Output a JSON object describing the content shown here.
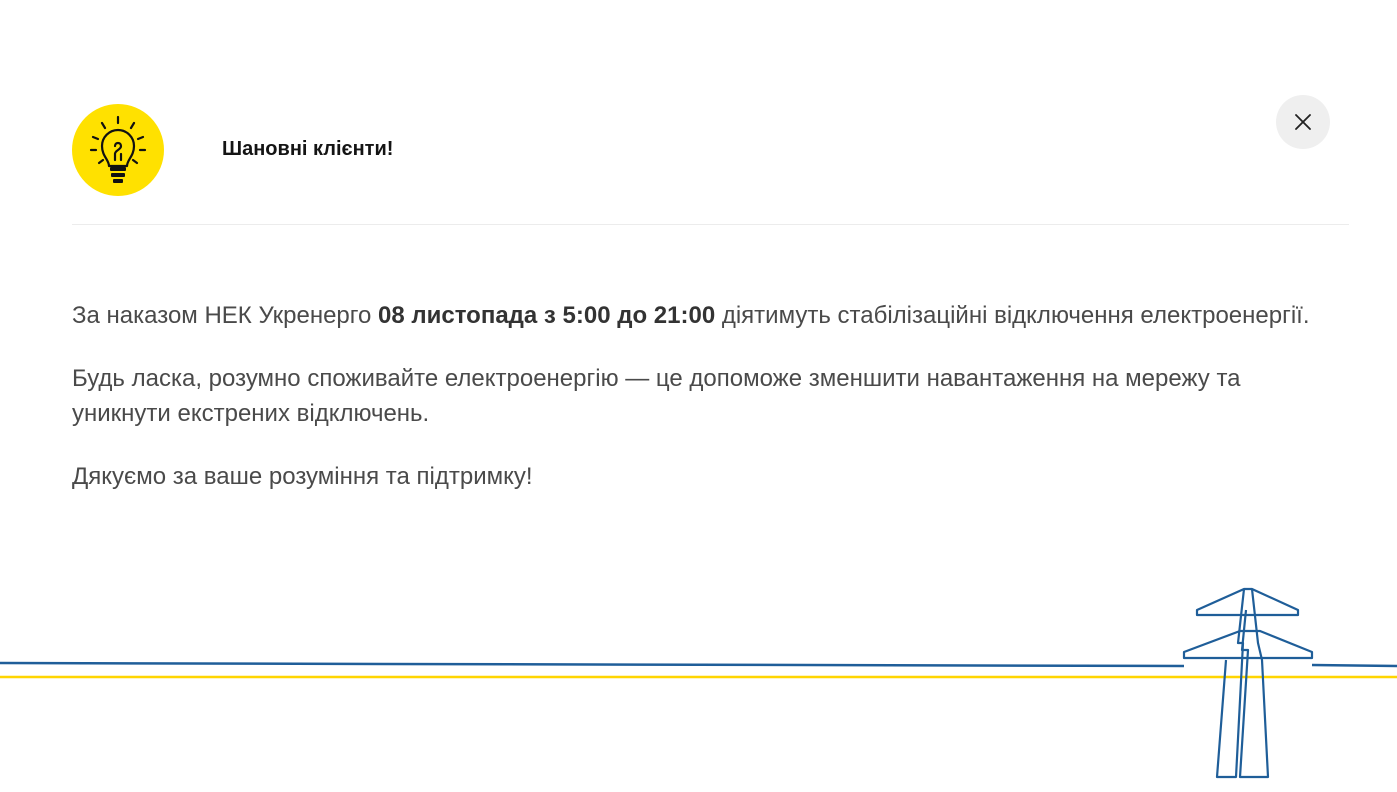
{
  "header": {
    "title": "Шановні клієнти!",
    "icon": "lightbulb-icon"
  },
  "close_button": {
    "icon": "close-icon"
  },
  "message": {
    "p1_before": "За наказом НЕК Укренерго ",
    "p1_bold": "08 листопада з 5:00 до 21:00",
    "p1_after": " діятимуть стабілізаційні відключення електроенергії.",
    "p2": "Будь ласка, розумно споживайте електроенергію — це допоможе зменшити навантаження на мережу та уникнути екстрених відключень.",
    "p3": "Дякуємо за ваше розуміння та підтримку!"
  },
  "decoration": {
    "icon": "power-tower-icon"
  },
  "colors": {
    "accent_yellow": "#FFE100",
    "line_blue": "#1F5E99",
    "line_yellow": "#FFD500",
    "text": "#4A4A4A",
    "title": "#141414",
    "close_bg": "#EFEFEF"
  }
}
